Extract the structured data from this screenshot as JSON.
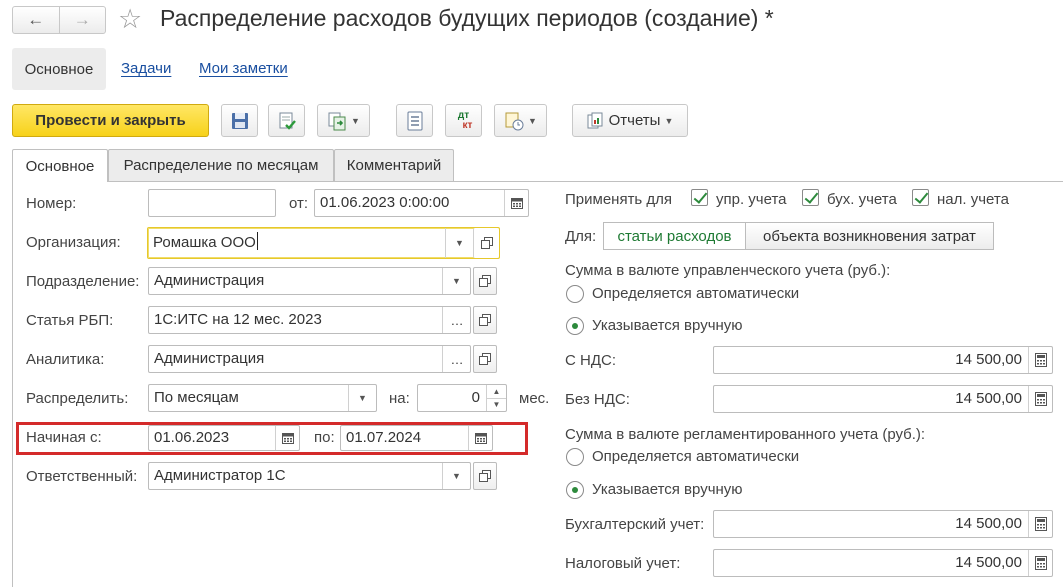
{
  "window": {
    "title": "Распределение расходов будущих периодов (создание) *"
  },
  "nav": {
    "main_tab": "Основное",
    "links": [
      "Задачи",
      "Мои заметки"
    ]
  },
  "toolbar": {
    "post_and_close": "Провести и закрыть",
    "dtkt_top": "дт",
    "dtkt_bottom": "кт",
    "reports": "Отчеты"
  },
  "tabs": [
    "Основное",
    "Распределение по месяцам",
    "Комментарий"
  ],
  "form": {
    "number": {
      "label": "Номер:",
      "value": ""
    },
    "from": {
      "label": "от:",
      "value": "01.06.2023  0:00:00"
    },
    "organization": {
      "label": "Организация:",
      "value": "Ромашка ООО"
    },
    "department": {
      "label": "Подразделение:",
      "value": "Администрация"
    },
    "rbp_item": {
      "label": "Статья РБП:",
      "value": "1С:ИТС на 12 мес. 2023"
    },
    "analytics": {
      "label": "Аналитика:",
      "value": "Администрация"
    },
    "distribute": {
      "label": "Распределить:",
      "value": "По месяцам",
      "on_label": "на:",
      "months_value": "0",
      "months_unit": "мес."
    },
    "start": {
      "label": "Начиная с:",
      "value": "01.06.2023",
      "to_label": "по:",
      "to_value": "01.07.2024"
    },
    "responsible": {
      "label": "Ответственный:",
      "value": "Администратор 1С"
    }
  },
  "right": {
    "apply_label": "Применять для",
    "checks": [
      {
        "label": "упр. учета",
        "checked": true
      },
      {
        "label": "бух. учета",
        "checked": true
      },
      {
        "label": "нал. учета",
        "checked": true
      }
    ],
    "for_label": "Для:",
    "segments": [
      {
        "label": "статьи расходов",
        "active": true
      },
      {
        "label": "объекта возникновения затрат",
        "active": false
      }
    ],
    "mgmt": {
      "heading": "Сумма в валюте управленческого учета (руб.):",
      "auto": "Определяется автоматически",
      "manual": "Указывается вручную",
      "selected": "manual",
      "with_vat": {
        "label": "С НДС:",
        "value": "14 500,00"
      },
      "without_vat": {
        "label": "Без НДС:",
        "value": "14 500,00"
      }
    },
    "reg": {
      "heading": "Сумма в валюте регламентированного учета (руб.):",
      "auto": "Определяется автоматически",
      "manual": "Указывается вручную",
      "selected": "manual",
      "accounting": {
        "label": "Бухгалтерский учет:",
        "value": "14 500,00"
      },
      "tax": {
        "label": "Налоговый учет:",
        "value": "14 500,00"
      }
    }
  },
  "colors": {
    "accent": "#f7d21a",
    "link": "#1a4fa0",
    "check": "#2d8a3c",
    "highlight": "#d42a2a",
    "active_segment_text": "#1e7a33"
  }
}
